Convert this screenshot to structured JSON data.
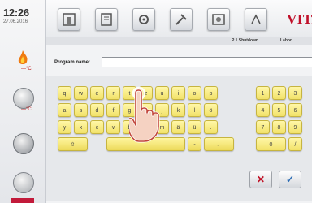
{
  "status": {
    "time": "12:26",
    "date": "27.06.2016",
    "flame_temp": "—°C",
    "vac_temp": "—°C"
  },
  "brand": "VITA",
  "tabs": [
    "P 1 Shutdown",
    "Labor"
  ],
  "program_name": {
    "label": "Program name:",
    "value": ""
  },
  "keyboard": {
    "row1": [
      "q",
      "w",
      "e",
      "r",
      "t",
      "z",
      "u",
      "i",
      "o",
      "p"
    ],
    "row2": [
      "a",
      "s",
      "d",
      "f",
      "g",
      "h",
      "j",
      "k",
      "l",
      "ö"
    ],
    "row3": [
      "y",
      "x",
      "c",
      "v",
      "b",
      "n",
      "m",
      "ä",
      "ü",
      "."
    ],
    "numpad_row1": [
      "1",
      "2",
      "3"
    ],
    "numpad_row2": [
      "4",
      "5",
      "6"
    ],
    "numpad_row3": [
      "7",
      "8",
      "9"
    ],
    "numpad_row4": [
      "0",
      "/"
    ],
    "shift_label": "⇧",
    "dash_label": "-",
    "backspace_label": "←"
  },
  "actions": {
    "cancel": "✕",
    "ok": "✓"
  },
  "colors": {
    "accent_red": "#c0102a",
    "key_yellow": "#f2e26a",
    "ok_blue": "#2b6bb3"
  }
}
